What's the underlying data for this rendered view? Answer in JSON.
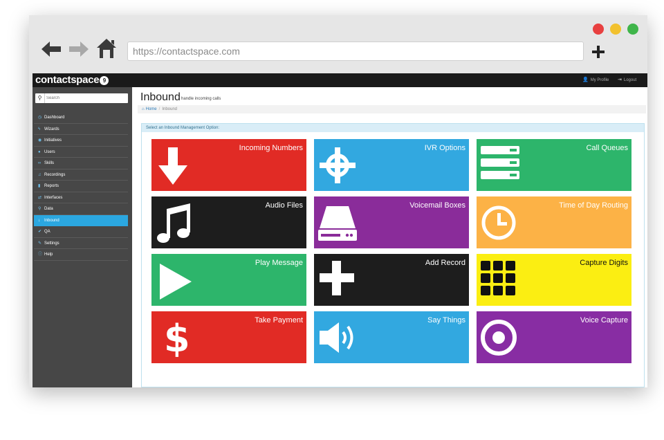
{
  "browser": {
    "url": "https://contactspace.com"
  },
  "app": {
    "logo": "contactspace",
    "logo_mark": "9",
    "top_links": {
      "profile": "My Profile",
      "logout": "Logout"
    }
  },
  "sidebar": {
    "search_placeholder": "Search",
    "items": [
      {
        "label": "Dashboard",
        "icon": "clock-icon"
      },
      {
        "label": "Wizards",
        "icon": "bolt-icon"
      },
      {
        "label": "Initiatives",
        "icon": "circle-icon"
      },
      {
        "label": "Users",
        "icon": "user-icon"
      },
      {
        "label": "Skills",
        "icon": "link-icon"
      },
      {
        "label": "Recordings",
        "icon": "music-icon"
      },
      {
        "label": "Reports",
        "icon": "bar-chart-icon"
      },
      {
        "label": "Interfaces",
        "icon": "arrows-icon"
      },
      {
        "label": "Data",
        "icon": "search-icon"
      },
      {
        "label": "Inbound",
        "icon": "arrow-down-icon",
        "active": true
      },
      {
        "label": "QA",
        "icon": "check-icon"
      },
      {
        "label": "Settings",
        "icon": "wrench-icon"
      },
      {
        "label": "Help",
        "icon": "info-icon"
      }
    ]
  },
  "page": {
    "title": "Inbound",
    "subtitle": "handle incoming calls",
    "breadcrumb": {
      "home": "Home",
      "current": "Inbound"
    },
    "panel_heading": "Select an Inbound Management Option:"
  },
  "tiles": [
    {
      "label": "Incoming Numbers",
      "icon": "arrow-down-icon",
      "color": "#e12b25"
    },
    {
      "label": "IVR Options",
      "icon": "crosshairs-icon",
      "color": "#32a8e0"
    },
    {
      "label": "Call Queues",
      "icon": "queue-list-icon",
      "color": "#2db56b"
    },
    {
      "label": "Audio Files",
      "icon": "music-icon",
      "color": "#1d1d1d"
    },
    {
      "label": "Voicemail Boxes",
      "icon": "hard-drive-icon",
      "color": "#8a2c9a"
    },
    {
      "label": "Time of Day Routing",
      "icon": "clock-icon",
      "color": "#fcb246"
    },
    {
      "label": "Play Message",
      "icon": "play-icon",
      "color": "#2db56b"
    },
    {
      "label": "Add Record",
      "icon": "plus-icon",
      "color": "#1d1d1d"
    },
    {
      "label": "Capture Digits",
      "icon": "keypad-icon",
      "color": "#fbee12"
    },
    {
      "label": "Take Payment",
      "icon": "dollar-icon",
      "color": "#e12b25"
    },
    {
      "label": "Say Things",
      "icon": "speaker-icon",
      "color": "#32a8e0"
    },
    {
      "label": "Voice Capture",
      "icon": "record-icon",
      "color": "#882da3"
    }
  ]
}
